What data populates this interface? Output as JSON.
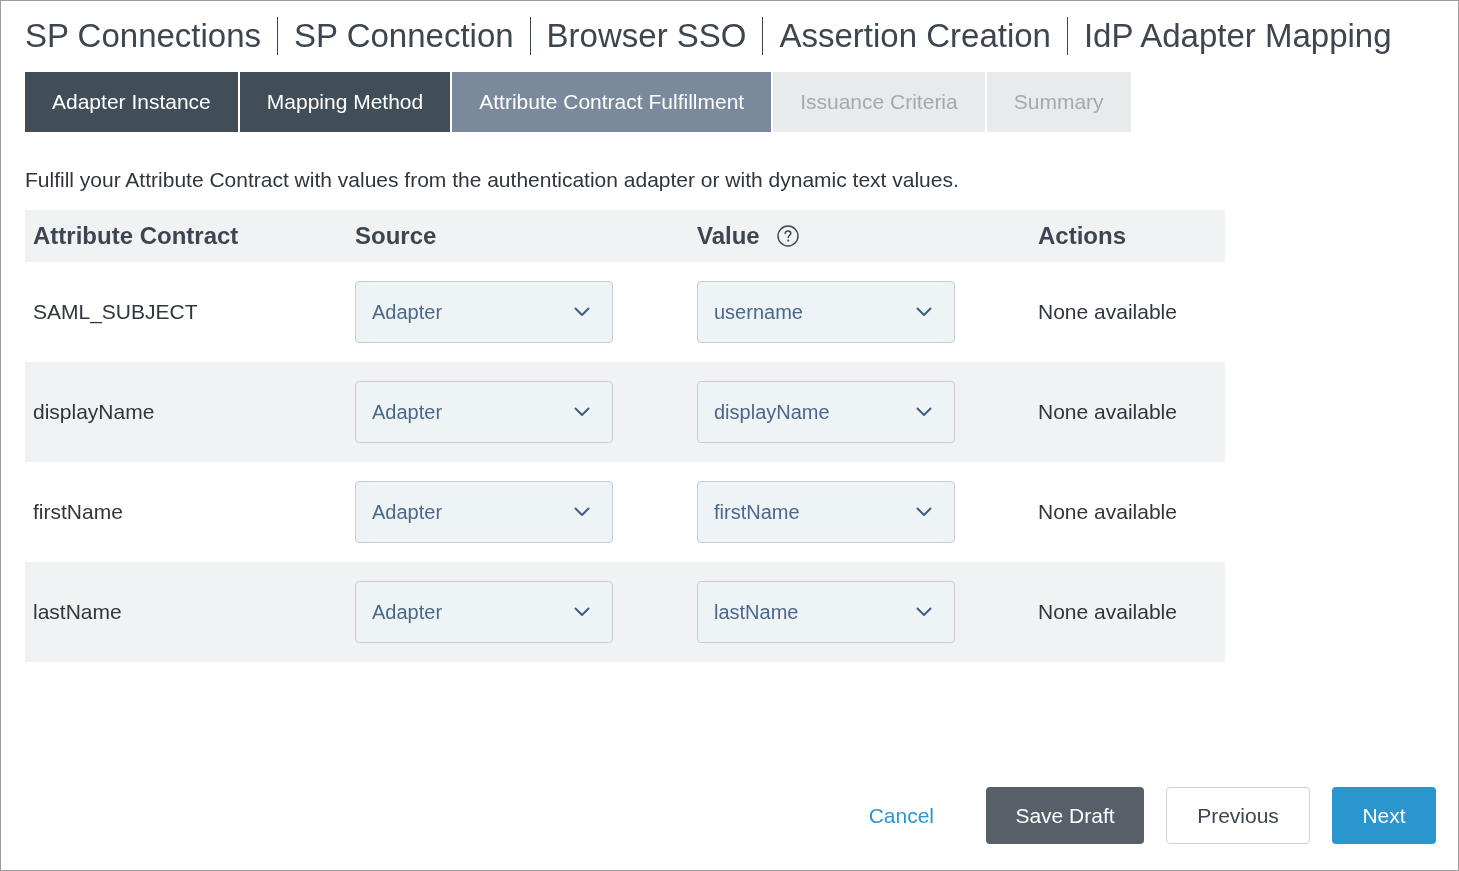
{
  "breadcrumb": [
    "SP Connections",
    "SP Connection",
    "Browser SSO",
    "Assertion Creation",
    "IdP Adapter Mapping"
  ],
  "tabs": [
    {
      "label": "Adapter Instance",
      "selected": false,
      "completed": true
    },
    {
      "label": "Mapping Method",
      "selected": false,
      "completed": true
    },
    {
      "label": "Attribute Contract Fulfillment",
      "selected": true,
      "completed": false
    },
    {
      "label": "Issuance Criteria",
      "selected": false,
      "completed": false
    },
    {
      "label": "Summary",
      "selected": false,
      "completed": false
    }
  ],
  "description": "Fulfill your Attribute Contract with values from the authentication adapter or with dynamic text values.",
  "table": {
    "columns": [
      {
        "label": "Attribute Contract",
        "help": false
      },
      {
        "label": "Source",
        "help": false
      },
      {
        "label": "Value",
        "help": true
      },
      {
        "label": "Actions",
        "help": false
      }
    ],
    "rows": [
      {
        "attribute": "SAML_SUBJECT",
        "source": "Adapter",
        "value": "username",
        "actions": "None available"
      },
      {
        "attribute": "displayName",
        "source": "Adapter",
        "value": "displayName",
        "actions": "None available"
      },
      {
        "attribute": "firstName",
        "source": "Adapter",
        "value": "firstName",
        "actions": "None available"
      },
      {
        "attribute": "lastName",
        "source": "Adapter",
        "value": "lastName",
        "actions": "None available"
      }
    ]
  },
  "buttons": [
    {
      "label": "Cancel",
      "kind": "link"
    },
    {
      "label": "Save Draft",
      "kind": "secondary"
    },
    {
      "label": "Previous",
      "kind": "outline"
    },
    {
      "label": "Next",
      "kind": "primary"
    }
  ]
}
